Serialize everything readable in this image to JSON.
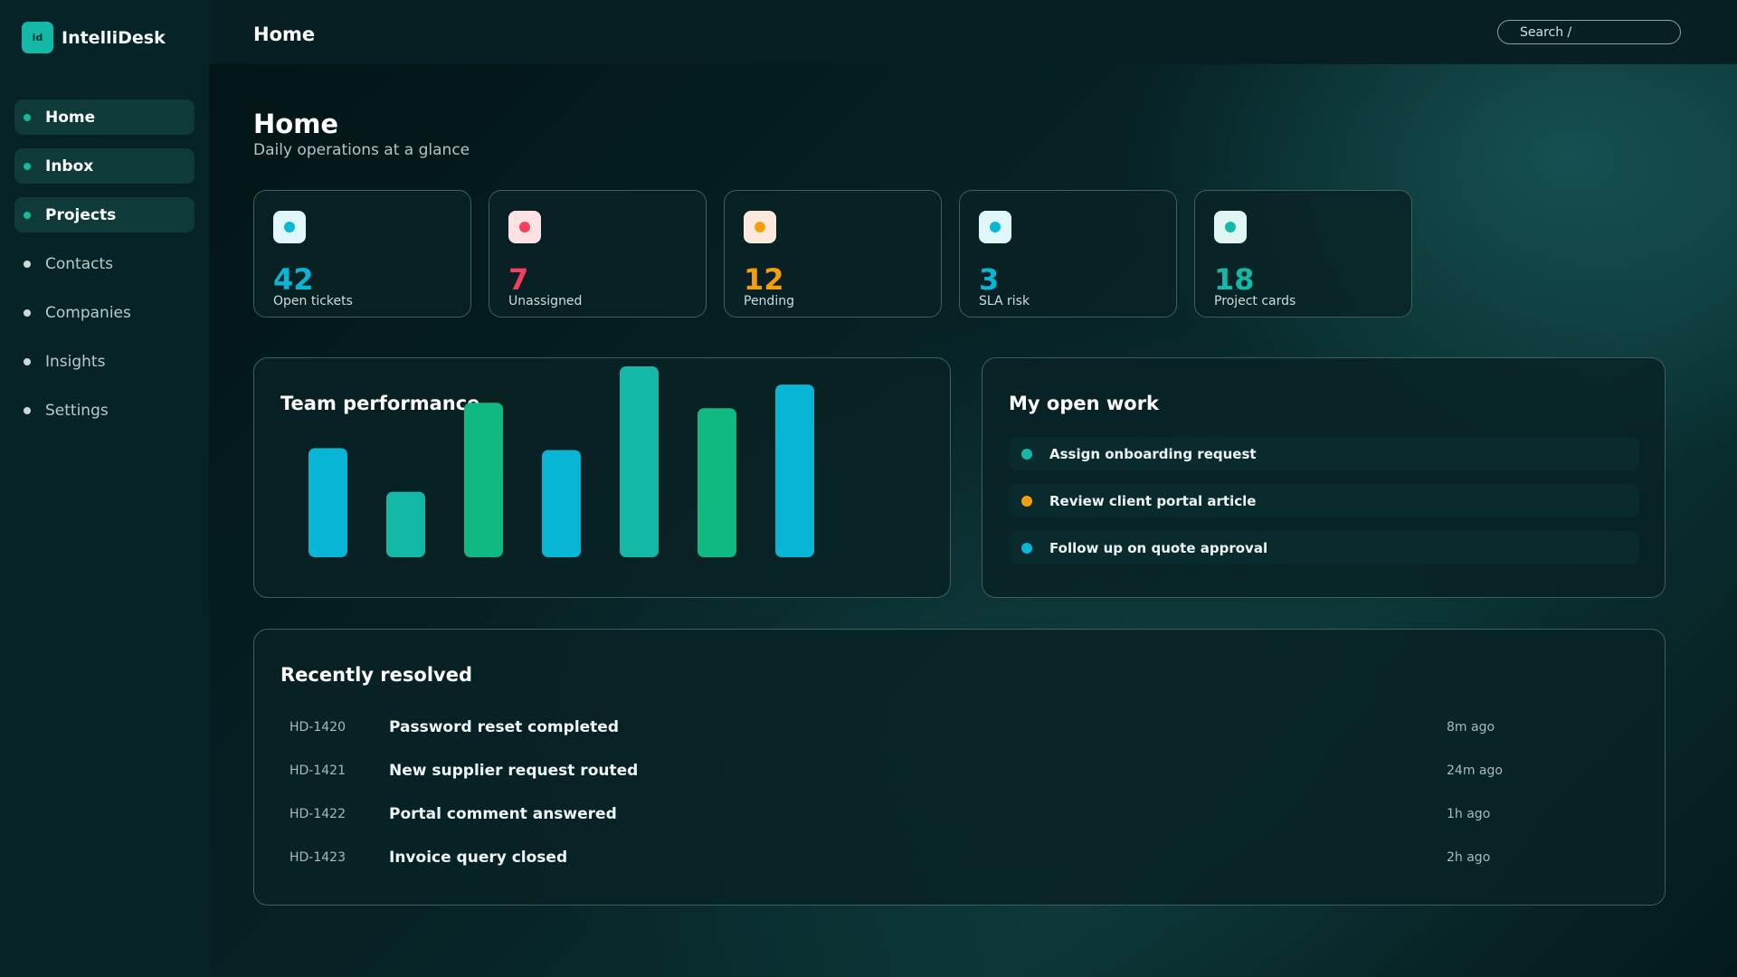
{
  "app": {
    "name": "IntelliDesk",
    "logo_text": "id"
  },
  "sidebar": {
    "items": [
      {
        "label": "Home",
        "active": true
      },
      {
        "label": "Inbox",
        "active": true
      },
      {
        "label": "Projects",
        "active": true
      },
      {
        "label": "Contacts",
        "active": false
      },
      {
        "label": "Companies",
        "active": false
      },
      {
        "label": "Insights",
        "active": false
      },
      {
        "label": "Settings",
        "active": false
      }
    ]
  },
  "topbar": {
    "title": "Home",
    "search_placeholder": "Search /"
  },
  "page": {
    "title": "Home",
    "subtitle": "Daily operations at a glance"
  },
  "stats": [
    {
      "value": "42",
      "label": "Open tickets",
      "color": "#06b6d4",
      "icon_bg": "#e0f7fa"
    },
    {
      "value": "7",
      "label": "Unassigned",
      "color": "#f43f5e",
      "icon_bg": "#fde2e4"
    },
    {
      "value": "12",
      "label": "Pending",
      "color": "#f59e0b",
      "icon_bg": "#fde9dc"
    },
    {
      "value": "3",
      "label": "SLA risk",
      "color": "#06b6d4",
      "icon_bg": "#e0f7fa"
    },
    {
      "value": "18",
      "label": "Project cards",
      "color": "#14b8a6",
      "icon_bg": "#dff6f2"
    }
  ],
  "performance": {
    "title": "Team performance"
  },
  "chart_data": {
    "type": "bar",
    "title": "Team performance",
    "categories": [
      "",
      "",
      "",
      "",
      "",
      "",
      ""
    ],
    "values": [
      60,
      36,
      85,
      59,
      105,
      82,
      95
    ],
    "colors": [
      "#06b6d4",
      "#14b8a6",
      "#10b981",
      "#06b6d4",
      "#14b8a6",
      "#10b981",
      "#06b6d4"
    ],
    "ylim": [
      0,
      105
    ],
    "grid": false
  },
  "open_work": {
    "title": "My open work",
    "items": [
      {
        "label": "Assign onboarding request",
        "color": "#14b8a6"
      },
      {
        "label": "Review client portal article",
        "color": "#f59e0b"
      },
      {
        "label": "Follow up on quote approval",
        "color": "#06b6d4"
      }
    ]
  },
  "resolved": {
    "title": "Recently resolved",
    "rows": [
      {
        "id": "HD-1420",
        "text": "Password reset completed",
        "time": "8m ago"
      },
      {
        "id": "HD-1421",
        "text": "New supplier request routed",
        "time": "24m ago"
      },
      {
        "id": "HD-1422",
        "text": "Portal comment answered",
        "time": "1h ago"
      },
      {
        "id": "HD-1423",
        "text": "Invoice query closed",
        "time": "2h ago"
      }
    ]
  }
}
